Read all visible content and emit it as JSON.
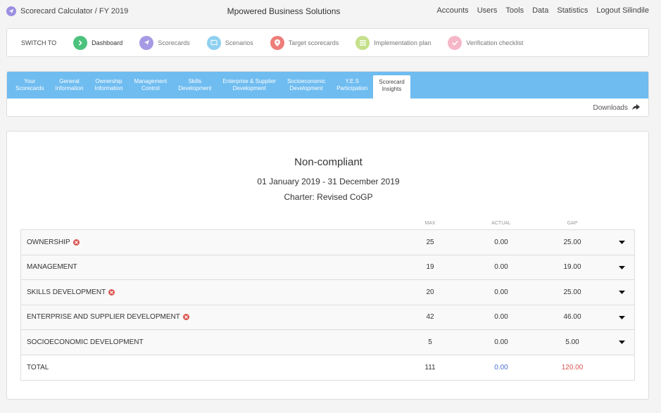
{
  "header": {
    "app_title": "Scorecard Calculator / FY 2019",
    "company": "Mpowered Business Solutions",
    "nav": [
      "Accounts",
      "Users",
      "Tools",
      "Data",
      "Statistics",
      "Logout Silindile"
    ]
  },
  "switch": {
    "label": "SWITCH TO",
    "items": [
      {
        "label": "Dashboard",
        "icon": "chevron-right-icon",
        "color": "#4cc27d"
      },
      {
        "label": "Scorecards",
        "icon": "paper-plane-icon",
        "color": "#a69ae4"
      },
      {
        "label": "Scenarios",
        "icon": "map-icon",
        "color": "#8fd0f0"
      },
      {
        "label": "Target scorecards",
        "icon": "pin-icon",
        "color": "#ee7d78"
      },
      {
        "label": "Implementation plan",
        "icon": "list-icon",
        "color": "#c5e08a"
      },
      {
        "label": "Verification checklist",
        "icon": "check-icon",
        "color": "#f5b7c8"
      }
    ]
  },
  "tabs": [
    {
      "line1": "Your",
      "line2": "Scorecards"
    },
    {
      "line1": "General",
      "line2": "Information"
    },
    {
      "line1": "Ownership",
      "line2": "Information"
    },
    {
      "line1": "Management",
      "line2": "Control"
    },
    {
      "line1": "Skills",
      "line2": "Development"
    },
    {
      "line1": "Enterprise & Supplier",
      "line2": "Development"
    },
    {
      "line1": "Socioeconomic",
      "line2": "Development"
    },
    {
      "line1": "Y.E.S",
      "line2": "Participation"
    },
    {
      "line1": "Scorecard",
      "line2": "Insights"
    }
  ],
  "active_tab": 8,
  "downloads_label": "Downloads",
  "summary": {
    "status": "Non-compliant",
    "period": "01 January 2019 - 31 December 2019",
    "charter": "Charter: Revised CoGP"
  },
  "columns": {
    "max": "MAX",
    "actual": "ACTUAL",
    "gap": "GAP"
  },
  "rows": [
    {
      "name": "OWNERSHIP",
      "flag": true,
      "max": "25",
      "actual": "0.00",
      "gap": "25.00"
    },
    {
      "name": "MANAGEMENT",
      "flag": false,
      "max": "19",
      "actual": "0.00",
      "gap": "19.00"
    },
    {
      "name": "SKILLS DEVELOPMENT",
      "flag": true,
      "max": "20",
      "actual": "0.00",
      "gap": "25.00"
    },
    {
      "name": "ENTERPRISE AND SUPPLIER DEVELOPMENT",
      "flag": true,
      "max": "42",
      "actual": "0.00",
      "gap": "46.00"
    },
    {
      "name": "SOCIOECONOMIC DEVELOPMENT",
      "flag": false,
      "max": "5",
      "actual": "0.00",
      "gap": "5.00"
    }
  ],
  "total": {
    "name": "TOTAL",
    "max": "111",
    "actual": "0.00",
    "gap": "120.00"
  }
}
